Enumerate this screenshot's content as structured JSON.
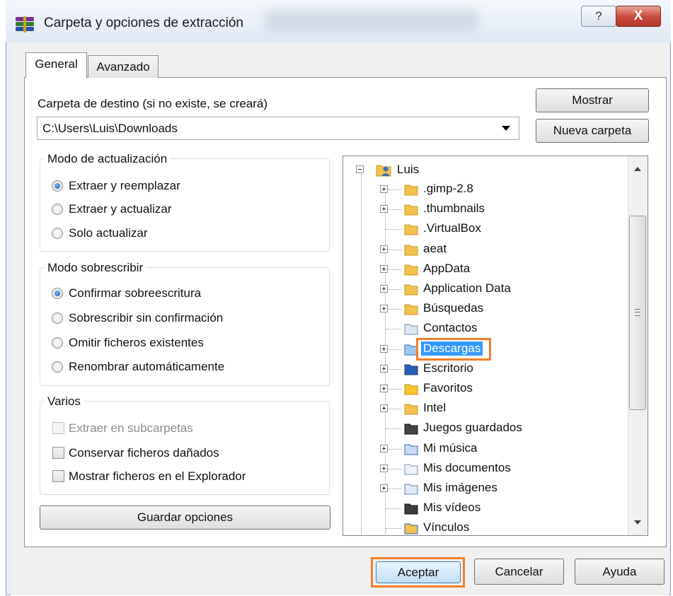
{
  "window": {
    "title": "Carpeta y opciones de extracción",
    "help_label": "?",
    "close_label": "X"
  },
  "tabs": [
    {
      "label": "General",
      "active": true
    },
    {
      "label": "Avanzado",
      "active": false
    }
  ],
  "destination": {
    "label": "Carpeta de destino (si no existe, se creará)",
    "value": "C:\\Users\\Luis\\Downloads"
  },
  "buttons": {
    "show": "Mostrar",
    "new_folder": "Nueva carpeta",
    "save_options": "Guardar opciones",
    "accept": "Aceptar",
    "cancel": "Cancelar",
    "help": "Ayuda"
  },
  "update_mode": {
    "title": "Modo de actualización",
    "options": [
      {
        "label": "Extraer y reemplazar",
        "checked": true
      },
      {
        "label": "Extraer y actualizar",
        "checked": false
      },
      {
        "label": "Solo actualizar",
        "checked": false
      }
    ]
  },
  "overwrite_mode": {
    "title": "Modo sobrescribir",
    "options": [
      {
        "label": "Confirmar sobreescritura",
        "checked": true
      },
      {
        "label": "Sobrescribir sin confirmación",
        "checked": false
      },
      {
        "label": "Omitir ficheros existentes",
        "checked": false
      },
      {
        "label": "Renombrar automáticamente",
        "checked": false
      }
    ]
  },
  "misc": {
    "title": "Varios",
    "options": [
      {
        "label": "Extraer en subcarpetas",
        "checked": false,
        "disabled": true
      },
      {
        "label": "Conservar ficheros dañados",
        "checked": false,
        "disabled": false
      },
      {
        "label": "Mostrar ficheros en el Explorador",
        "checked": false,
        "disabled": false
      }
    ]
  },
  "tree": {
    "root": "Luis",
    "items": [
      {
        "label": ".gimp-2.8",
        "expandable": true,
        "icon": "folder-icon"
      },
      {
        "label": ".thumbnails",
        "expandable": true,
        "icon": "folder-icon"
      },
      {
        "label": ".VirtualBox",
        "expandable": false,
        "icon": "folder-icon"
      },
      {
        "label": "aeat",
        "expandable": true,
        "icon": "folder-icon"
      },
      {
        "label": "AppData",
        "expandable": true,
        "icon": "folder-icon"
      },
      {
        "label": "Application Data",
        "expandable": true,
        "icon": "folder-icon"
      },
      {
        "label": "Búsquedas",
        "expandable": true,
        "icon": "search-folder-icon"
      },
      {
        "label": "Contactos",
        "expandable": false,
        "icon": "contacts-icon"
      },
      {
        "label": "Descargas",
        "expandable": true,
        "icon": "downloads-icon",
        "selected": true
      },
      {
        "label": "Escritorio",
        "expandable": true,
        "icon": "desktop-icon"
      },
      {
        "label": "Favoritos",
        "expandable": true,
        "icon": "favorites-icon"
      },
      {
        "label": "Intel",
        "expandable": true,
        "icon": "folder-icon"
      },
      {
        "label": "Juegos guardados",
        "expandable": false,
        "icon": "saved-games-icon"
      },
      {
        "label": "Mi música",
        "expandable": true,
        "icon": "music-icon"
      },
      {
        "label": "Mis documentos",
        "expandable": true,
        "icon": "documents-icon"
      },
      {
        "label": "Mis imágenes",
        "expandable": true,
        "icon": "pictures-icon"
      },
      {
        "label": "Mis vídeos",
        "expandable": false,
        "icon": "videos-icon"
      },
      {
        "label": "Vínculos",
        "expandable": false,
        "icon": "links-icon"
      }
    ]
  },
  "colors": {
    "highlight": "#f37e2a",
    "selection": "#3399ff",
    "folder": "#f2c14e"
  }
}
